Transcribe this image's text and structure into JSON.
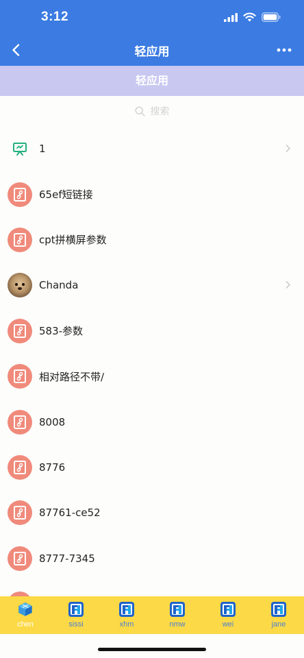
{
  "status": {
    "time": "3:12"
  },
  "nav": {
    "title": "轻应用"
  },
  "section": {
    "title": "轻应用"
  },
  "search": {
    "placeholder": "搜索"
  },
  "colors": {
    "primary": "#3b7be2",
    "section": "#c8c8f1",
    "link_icon": "#f08a7b",
    "tab_bar": "#fcd946",
    "tab_label": "#4a7fd4"
  },
  "items": [
    {
      "label": "1",
      "icon": "presentation-icon",
      "chevron": true
    },
    {
      "label": "65ef短链接",
      "icon": "link-icon",
      "chevron": false
    },
    {
      "label": "cpt拼横屏参数",
      "icon": "link-icon",
      "chevron": false
    },
    {
      "label": "Chanda",
      "icon": "avatar",
      "chevron": true
    },
    {
      "label": "583-参数",
      "icon": "link-icon",
      "chevron": false
    },
    {
      "label": "相对路径不带/",
      "icon": "link-icon",
      "chevron": false
    },
    {
      "label": "8008",
      "icon": "link-icon",
      "chevron": false
    },
    {
      "label": "8776",
      "icon": "link-icon",
      "chevron": false
    },
    {
      "label": "87761-ce52",
      "icon": "link-icon",
      "chevron": false
    },
    {
      "label": "8777-7345",
      "icon": "link-icon",
      "chevron": false
    }
  ],
  "tabs": [
    {
      "label": "chen",
      "icon": "cube-logo-icon",
      "active": true
    },
    {
      "label": "sissi",
      "icon": "app-logo-icon",
      "active": false
    },
    {
      "label": "xhm",
      "icon": "app-logo-icon",
      "active": false
    },
    {
      "label": "nmw",
      "icon": "app-logo-icon",
      "active": false
    },
    {
      "label": "wei",
      "icon": "app-logo-icon",
      "active": false
    },
    {
      "label": "jane",
      "icon": "app-logo-icon",
      "active": false
    }
  ]
}
